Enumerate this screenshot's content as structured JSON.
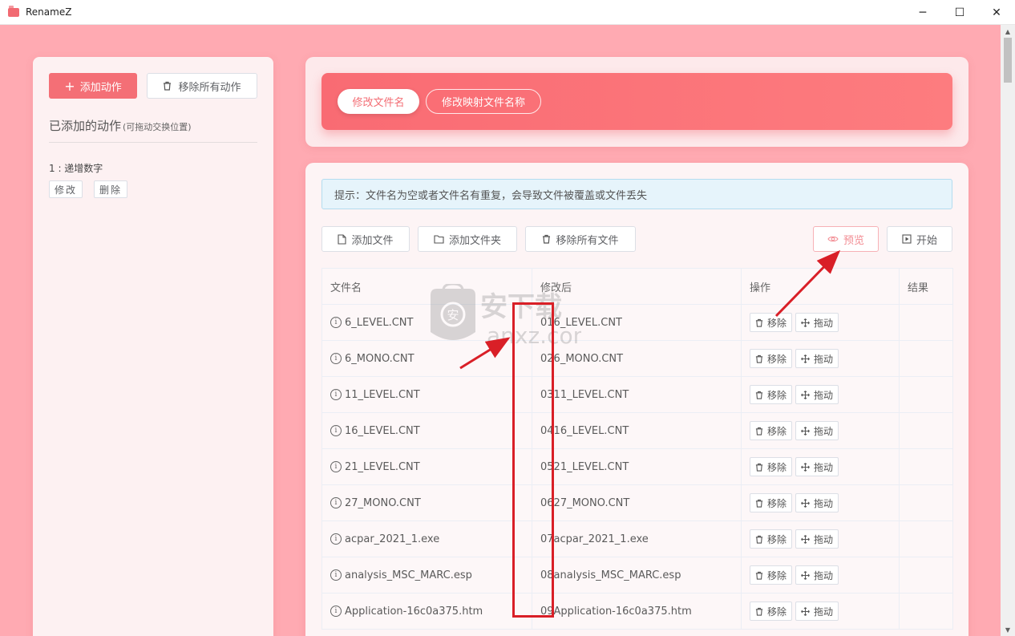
{
  "window": {
    "title": "RenameZ",
    "minimize": "─",
    "maximize": "☐",
    "close": "✕"
  },
  "scrollbar": {
    "up": "▲",
    "down": "▼"
  },
  "sidebar": {
    "add_action_label": "添加动作",
    "add_action_icon": "+",
    "remove_all_actions_label": "移除所有动作",
    "added_title": "已添加的动作",
    "added_hint": "(可拖动交换位置)",
    "action_item": "1 : 递增数字",
    "edit_label": "修改",
    "delete_label": "删除"
  },
  "tabs": [
    {
      "label": "修改文件名",
      "active": true
    },
    {
      "label": "修改映射文件名称",
      "active": false
    }
  ],
  "tip": "提示：文件名为空或者文件名有重复，会导致文件被覆盖或文件丢失",
  "toolbar": {
    "add_file": "添加文件",
    "add_folder": "添加文件夹",
    "remove_all_files": "移除所有文件",
    "preview": "预览",
    "start": "开始"
  },
  "table": {
    "headers": {
      "name": "文件名",
      "modified": "修改后",
      "ops": "操作",
      "result": "结果"
    },
    "rows": [
      {
        "name": "6_LEVEL.CNT",
        "modified": "016_LEVEL.CNT"
      },
      {
        "name": "6_MONO.CNT",
        "modified": "026_MONO.CNT"
      },
      {
        "name": "11_LEVEL.CNT",
        "modified": "0311_LEVEL.CNT"
      },
      {
        "name": "16_LEVEL.CNT",
        "modified": "0416_LEVEL.CNT"
      },
      {
        "name": "21_LEVEL.CNT",
        "modified": "0521_LEVEL.CNT"
      },
      {
        "name": "27_MONO.CNT",
        "modified": "0627_MONO.CNT"
      },
      {
        "name": "acpar_2021_1.exe",
        "modified": "07acpar_2021_1.exe"
      },
      {
        "name": "analysis_MSC_MARC.esp",
        "modified": "08analysis_MSC_MARC.esp"
      },
      {
        "name": "Application-16c0a375.htm",
        "modified": "09Application-16c0a375.htm"
      }
    ],
    "remove_label": "移除",
    "drag_label": "拖动"
  },
  "watermark": {
    "text": "安下载",
    "domain": "anxz.com",
    "badge": "安"
  },
  "colors": {
    "accent": "#f46f76",
    "background": "#ffaab2",
    "annotation": "#d91f27"
  }
}
